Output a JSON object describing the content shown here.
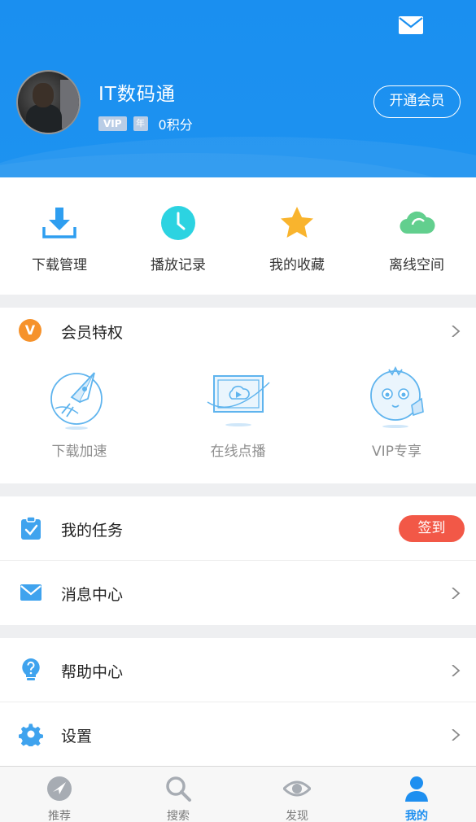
{
  "profile": {
    "username": "IT数码通",
    "vip_badge": "VIP",
    "year_badge": "年",
    "points": "0积分",
    "vip_button": "开通会员"
  },
  "quick_actions": [
    {
      "label": "下载管理",
      "icon": "download-icon"
    },
    {
      "label": "播放记录",
      "icon": "clock-icon"
    },
    {
      "label": "我的收藏",
      "icon": "star-icon"
    },
    {
      "label": "离线空间",
      "icon": "cloud-icon"
    }
  ],
  "vip_section": {
    "badge": "V",
    "title": "会员特权",
    "perks": [
      {
        "label": "下载加速",
        "icon": "rocket-icon"
      },
      {
        "label": "在线点播",
        "icon": "video-icon"
      },
      {
        "label": "VIP专享",
        "icon": "mascot-icon"
      }
    ]
  },
  "menu": {
    "tasks": {
      "label": "我的任务",
      "action": "签到"
    },
    "messages": {
      "label": "消息中心"
    },
    "help": {
      "label": "帮助中心"
    },
    "settings": {
      "label": "设置"
    }
  },
  "bottom_nav": [
    {
      "label": "推荐",
      "icon": "compass-icon"
    },
    {
      "label": "搜索",
      "icon": "search-icon"
    },
    {
      "label": "发现",
      "icon": "eye-icon"
    },
    {
      "label": "我的",
      "icon": "user-icon",
      "active": true
    }
  ],
  "colors": {
    "header_blue": "#1a8ff0",
    "accent_blue": "#1e8ff0",
    "vip_orange": "#f6922b",
    "checkin_red": "#f25847",
    "star_yellow": "#f9b42d",
    "clock_cyan": "#2cd3e1",
    "cloud_green": "#62cf8e"
  }
}
